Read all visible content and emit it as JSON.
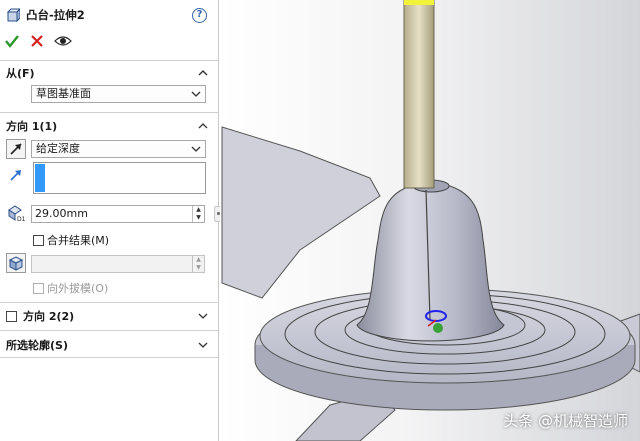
{
  "panel": {
    "title": "凸台-拉伸2",
    "help_label": "?",
    "from": {
      "header": "从(F)",
      "selected": "草图基准面"
    },
    "direction1": {
      "header": "方向 1(1)",
      "end_condition": "给定深度",
      "depth_value": "29.00mm",
      "merge_label": "合并结果(M)",
      "draft_outward_label": "向外拔模(O)"
    },
    "direction2": {
      "header": "方向 2(2)"
    },
    "contours": {
      "header": "所选轮廓(S)"
    }
  },
  "viewport": {
    "watermark": "头条 @机械智造师"
  },
  "colors": {
    "ok_green": "#2e9a2e",
    "cancel_red": "#d42020",
    "selection_blue": "#3399ff",
    "part_gray": "#c9cad6"
  }
}
